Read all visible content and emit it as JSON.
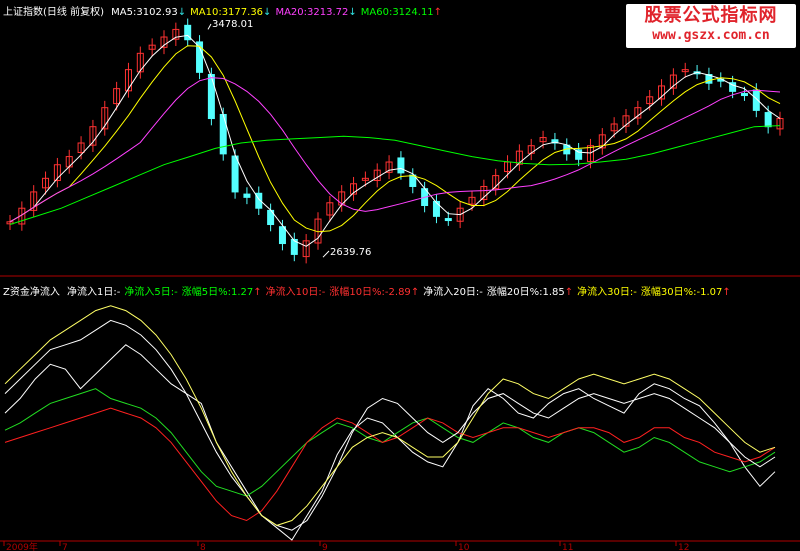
{
  "top_panel": {
    "index_name": "上证指数(日线 前复权)",
    "ma": [
      {
        "label": "MA5:3102.93",
        "arrow": "down",
        "color": "#ffffff"
      },
      {
        "label": "MA10:3177.36",
        "arrow": "down",
        "color": "#ffff00"
      },
      {
        "label": "MA20:3213.72",
        "arrow": "down",
        "color": "#ff40ff"
      },
      {
        "label": "MA60:3124.11",
        "arrow": "up",
        "color": "#00ff00"
      }
    ],
    "high_label": "3478.01",
    "low_label": "2639.76",
    "ylim": [
      2600,
      3520
    ]
  },
  "bottom_panel": {
    "title": "Z资金净流入",
    "items": [
      {
        "label": "净流入1日:-",
        "color": "#ffffff",
        "arrow": ""
      },
      {
        "label": "净流入5日:-",
        "color": "#00ff00",
        "arrow": ""
      },
      {
        "label": "涨幅5日%:1.27",
        "color": "#00ff00",
        "arrow": "up"
      },
      {
        "label": "净流入10日:-",
        "color": "#ff3030",
        "arrow": ""
      },
      {
        "label": "涨幅10日%:-2.89",
        "color": "#ff3030",
        "arrow": "up"
      },
      {
        "label": "净流入20日:-",
        "color": "#ffffff",
        "arrow": ""
      },
      {
        "label": "涨幅20日%:1.85",
        "color": "#ffffff",
        "arrow": "up"
      },
      {
        "label": "净流入30日:-",
        "color": "#ffff00",
        "arrow": ""
      },
      {
        "label": "涨幅30日%:-1.07",
        "color": "#ffff00",
        "arrow": "up"
      }
    ]
  },
  "x_axis": {
    "ticks": [
      "2009年",
      "7",
      "8",
      "9",
      "10",
      "11",
      "12"
    ]
  },
  "watermark": {
    "title": "股票公式指标网",
    "url": "www.gszx.com.cn"
  },
  "colors": {
    "up": "#ff3232",
    "down": "#54ffff",
    "ma5": "#ffffff",
    "ma10": "#ffff00",
    "ma20": "#ff40ff",
    "ma60": "#00ff00",
    "axis": "#b00000",
    "flow_white": "#ffffff",
    "flow_yellow": "#ffff66",
    "flow_green": "#22dd22",
    "flow_red": "#ff2020"
  },
  "chart_data": [
    {
      "type": "candlestick",
      "title": "上证指数(日线 前复权)",
      "close_trend": [
        2770,
        2820,
        2880,
        2930,
        2980,
        3010,
        3060,
        3120,
        3190,
        3260,
        3330,
        3390,
        3420,
        3450,
        3478,
        3440,
        3320,
        3150,
        3020,
        2880,
        2860,
        2820,
        2760,
        2690,
        2650,
        2700,
        2780,
        2840,
        2880,
        2910,
        2930,
        2960,
        2990,
        2950,
        2900,
        2830,
        2790,
        2780,
        2820,
        2860,
        2900,
        2940,
        2990,
        3030,
        3050,
        3080,
        3060,
        3020,
        3000,
        3050,
        3090,
        3130,
        3160,
        3190,
        3230,
        3270,
        3310,
        3330,
        3320,
        3280,
        3290,
        3250,
        3240,
        3180,
        3120,
        3150
      ],
      "ma60_trend": [
        2760,
        2790,
        2820,
        2860,
        2900,
        2940,
        2980,
        3010,
        3040,
        3060,
        3070,
        3075,
        3080,
        3085,
        3080,
        3070,
        3050,
        3030,
        3010,
        2995,
        2985,
        2980,
        2982,
        2990,
        3000,
        3020,
        3045,
        3070,
        3095,
        3120,
        3124
      ],
      "high": 3478.01,
      "low": 2639.76,
      "ylim": [
        2600,
        3520
      ]
    },
    {
      "type": "line",
      "title": "Z资金净流入",
      "series": [
        {
          "name": "净流入1日",
          "values": [
            52,
            58,
            66,
            72,
            70,
            62,
            68,
            74,
            80,
            76,
            70,
            64,
            60,
            56,
            40,
            30,
            20,
            10,
            5,
            0,
            10,
            20,
            35,
            45,
            50,
            48,
            42,
            36,
            32,
            30,
            40,
            55,
            62,
            58,
            52,
            50,
            56,
            60,
            62,
            58,
            55,
            52,
            60,
            64,
            62,
            58,
            55,
            48,
            40,
            30,
            22,
            28
          ]
        },
        {
          "name": "净流入5日",
          "values": [
            45,
            48,
            52,
            56,
            58,
            60,
            62,
            58,
            56,
            54,
            50,
            44,
            36,
            28,
            22,
            20,
            18,
            22,
            28,
            34,
            40,
            44,
            48,
            46,
            42,
            40,
            44,
            48,
            50,
            46,
            42,
            40,
            44,
            48,
            46,
            42,
            40,
            44,
            46,
            44,
            40,
            36,
            38,
            42,
            40,
            36,
            32,
            30,
            28,
            30,
            32,
            36
          ]
        },
        {
          "name": "净流入10日",
          "values": [
            40,
            42,
            44,
            46,
            48,
            50,
            52,
            54,
            52,
            50,
            46,
            40,
            32,
            24,
            16,
            10,
            8,
            12,
            20,
            30,
            40,
            46,
            50,
            48,
            44,
            40,
            42,
            46,
            50,
            48,
            44,
            42,
            44,
            46,
            46,
            44,
            42,
            44,
            46,
            46,
            44,
            40,
            42,
            46,
            46,
            42,
            40,
            36,
            34,
            32,
            34,
            38
          ]
        },
        {
          "name": "净流入20日",
          "values": [
            60,
            66,
            72,
            78,
            80,
            82,
            86,
            90,
            88,
            84,
            78,
            70,
            60,
            48,
            36,
            26,
            18,
            10,
            6,
            4,
            8,
            18,
            30,
            44,
            54,
            58,
            56,
            50,
            44,
            40,
            44,
            52,
            58,
            60,
            56,
            52,
            50,
            54,
            58,
            60,
            58,
            56,
            58,
            60,
            58,
            54,
            50,
            46,
            40,
            34,
            30,
            34
          ]
        },
        {
          "name": "净流入30日",
          "values": [
            64,
            70,
            76,
            82,
            86,
            90,
            94,
            96,
            94,
            90,
            84,
            76,
            66,
            54,
            40,
            28,
            18,
            10,
            6,
            8,
            14,
            22,
            30,
            38,
            42,
            44,
            42,
            38,
            34,
            34,
            40,
            50,
            60,
            66,
            64,
            60,
            58,
            62,
            66,
            68,
            66,
            64,
            66,
            68,
            66,
            62,
            58,
            52,
            46,
            40,
            36,
            38
          ]
        }
      ]
    }
  ]
}
